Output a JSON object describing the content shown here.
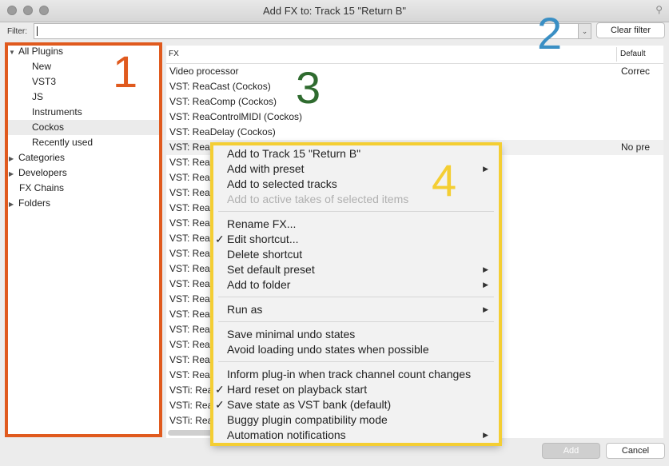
{
  "window": {
    "title": "Add FX to: Track 15 \"Return B\""
  },
  "filter": {
    "label": "Filter:",
    "value": "",
    "clear_label": "Clear filter"
  },
  "tree": [
    {
      "label": "All Plugins",
      "toggle": "▼",
      "indent": 0
    },
    {
      "label": "New",
      "toggle": "",
      "indent": 1
    },
    {
      "label": "VST3",
      "toggle": "",
      "indent": 1
    },
    {
      "label": "JS",
      "toggle": "",
      "indent": 1
    },
    {
      "label": "Instruments",
      "toggle": "",
      "indent": 1
    },
    {
      "label": "Cockos",
      "toggle": "",
      "indent": 1,
      "selected": true
    },
    {
      "label": "Recently used",
      "toggle": "",
      "indent": 1
    },
    {
      "label": "Categories",
      "toggle": "▶",
      "indent": 0
    },
    {
      "label": "Developers",
      "toggle": "▶",
      "indent": 0
    },
    {
      "label": "FX Chains",
      "toggle": "",
      "indent": 0
    },
    {
      "label": "Folders",
      "toggle": "▶",
      "indent": 0
    }
  ],
  "fx": {
    "columns": {
      "name": "FX",
      "default": "Default"
    },
    "rows": [
      {
        "name": "Video processor",
        "default": "Correc"
      },
      {
        "name": "VST: ReaCast (Cockos)",
        "default": ""
      },
      {
        "name": "VST: ReaComp (Cockos)",
        "default": ""
      },
      {
        "name": "VST: ReaControlMIDI (Cockos)",
        "default": ""
      },
      {
        "name": "VST: ReaDelay (Cockos)",
        "default": ""
      },
      {
        "name": "VST: Rea",
        "default": "No pre",
        "selected": true
      },
      {
        "name": "VST: Rea",
        "default": ""
      },
      {
        "name": "VST: Rea",
        "default": ""
      },
      {
        "name": "VST: Rea",
        "default": ""
      },
      {
        "name": "VST: Rea",
        "default": ""
      },
      {
        "name": "VST: Rea",
        "default": ""
      },
      {
        "name": "VST: Rea",
        "default": ""
      },
      {
        "name": "VST: Rea",
        "default": ""
      },
      {
        "name": "VST: Rea",
        "default": ""
      },
      {
        "name": "VST: Rea",
        "default": ""
      },
      {
        "name": "VST: Rea",
        "default": ""
      },
      {
        "name": "VST: Rea",
        "default": ""
      },
      {
        "name": "VST: Rea",
        "default": ""
      },
      {
        "name": "VST: Rea",
        "default": ""
      },
      {
        "name": "VST: Rea",
        "default": ""
      },
      {
        "name": "VST: Rea",
        "default": ""
      },
      {
        "name": "VSTi: Rea",
        "default": ""
      },
      {
        "name": "VSTi: Rea",
        "default": ""
      },
      {
        "name": "VSTi: Rea",
        "default": ""
      }
    ]
  },
  "context_menu": {
    "items": [
      {
        "label": "Add to Track 15 \"Return B\""
      },
      {
        "label": "Add with preset",
        "submenu": true
      },
      {
        "label": "Add to selected tracks"
      },
      {
        "label": "Add to active takes of selected items",
        "disabled": true
      },
      {
        "separator": true
      },
      {
        "label": "Rename FX..."
      },
      {
        "label": "Edit shortcut...",
        "checked": true
      },
      {
        "label": "Delete shortcut"
      },
      {
        "label": "Set default preset",
        "submenu": true
      },
      {
        "label": "Add to folder",
        "submenu": true
      },
      {
        "separator": true
      },
      {
        "label": "Run as",
        "submenu": true
      },
      {
        "separator": true
      },
      {
        "label": "Save minimal undo states"
      },
      {
        "label": "Avoid loading undo states when possible"
      },
      {
        "separator": true
      },
      {
        "label": "Inform plug-in when track channel count changes"
      },
      {
        "label": "Hard reset on playback start",
        "checked": true
      },
      {
        "label": "Save state as VST bank (default)",
        "checked": true
      },
      {
        "label": "Buggy plugin compatibility mode"
      },
      {
        "label": "Automation notifications",
        "submenu": true
      }
    ]
  },
  "buttons": {
    "add": "Add",
    "cancel": "Cancel"
  },
  "annotations": [
    {
      "label": "1",
      "color": "#e05a1e"
    },
    {
      "label": "2",
      "color": "#3a8fc4"
    },
    {
      "label": "3",
      "color": "#2f6b2f"
    },
    {
      "label": "4",
      "color": "#f4ce33"
    }
  ],
  "icons": {
    "pin": "pin-icon",
    "dropdown": "chevron-down-icon",
    "check": "checkmark-icon",
    "submenu": "triangle-right-icon"
  }
}
